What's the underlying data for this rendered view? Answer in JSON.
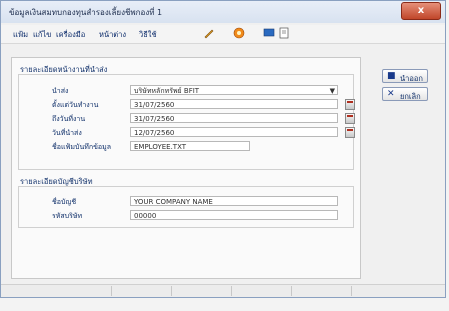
{
  "window": {
    "title": "ข้อมูลเงินสมทบกองทุนสำรองเลี้ยงชีพกองที่ 1",
    "close_label": "x"
  },
  "menu": [
    {
      "label": "แฟ้ม"
    },
    {
      "label": "แก้ไข"
    },
    {
      "label": "เครื่องมือ"
    },
    {
      "label": "หน้าต่าง"
    },
    {
      "label": "วิธีใช้"
    }
  ],
  "sections": {
    "employer": "รายละเอียดหน้างานที่นำส่ง",
    "account": "รายละเอียดบัญชีบริษัท"
  },
  "form": {
    "fund_label": "นำส่ง",
    "fund_value": "บริษัทหลักทรัพย์ BFIT",
    "start_date_label": "ตั้งแต่วันทำงาน",
    "start_date_value": "31/07/2560",
    "end_date_label": "ถึงวันที่งาน",
    "end_date_value": "31/07/2560",
    "send_date_label": "วันที่นำส่ง",
    "send_date_value": "12/07/2560",
    "file_label": "ชื่อแฟ้มบันทึกข้อมูล",
    "file_value": "EMPLOYEE.TXT",
    "account_name_label": "ชื่อบัญชี",
    "account_name_value": "YOUR COMPANY NAME",
    "account_no_label": "รหัสบริษัท",
    "account_no_value": "00000"
  },
  "buttons": {
    "save_label": "นำออก",
    "cancel_label": "ยกเลิก"
  }
}
